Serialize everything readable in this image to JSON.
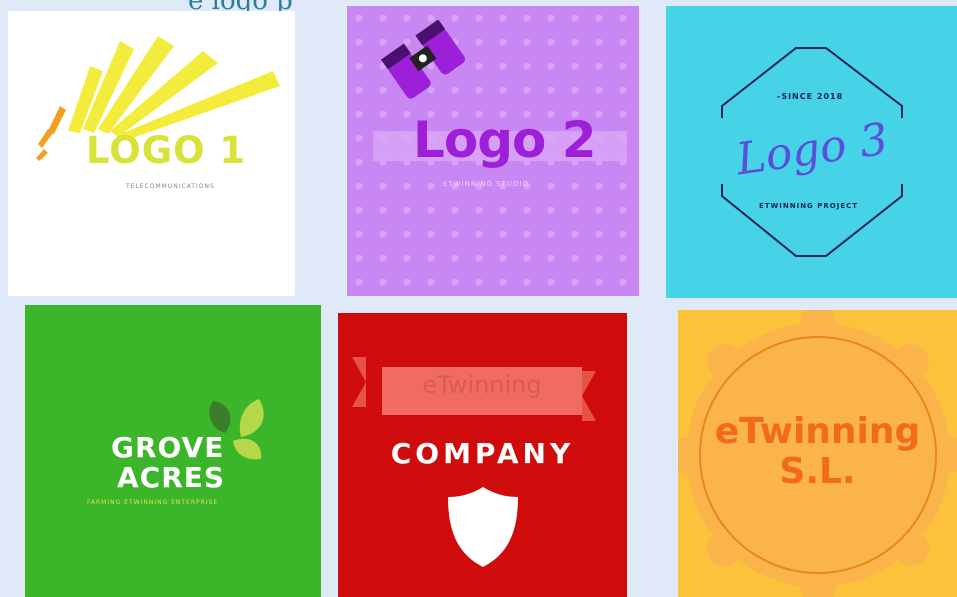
{
  "page": {
    "heading_fragment": "e logo p",
    "background": "#dfe9f7"
  },
  "tiles": [
    {
      "name": "LOGO 1",
      "subtitle": "TELECOMMUNICATIONS",
      "bg": "#ffffff",
      "accent": "#d8e238"
    },
    {
      "name": "Logo 2",
      "subtitle": "ETWINNING STUDIO",
      "bg": "#c987f3",
      "accent": "#9e1fd9",
      "icon": "binoculars-icon"
    },
    {
      "name": "Logo 3",
      "since": "-SINCE 2018",
      "subtitle": "ETWINNING PROJECT",
      "bg": "#46d3e8",
      "accent": "#5a4fd8"
    },
    {
      "line1": "GROVE",
      "line2": "ACRES",
      "subtitle": "FARMING ETWINNING ENTERPRISE",
      "bg": "#3bb52a",
      "icon": "leaves-icon"
    },
    {
      "banner": "eTwinning",
      "name": "COMPANY",
      "bg": "#cf0b0b",
      "icon": "shield-icon"
    },
    {
      "line1": "eTwinning",
      "line2": "S.L.",
      "bg": "#fdc23c",
      "accent": "#f26a1b",
      "icon": "badge-seal-icon"
    }
  ]
}
